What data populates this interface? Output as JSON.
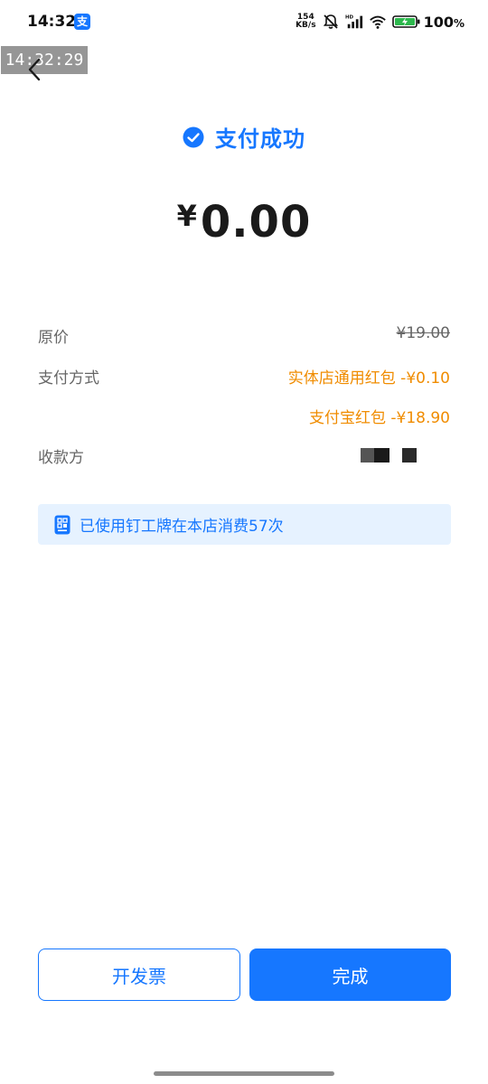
{
  "status_bar": {
    "time": "14:32",
    "app_glyph": "支",
    "net_speed_value": "154",
    "net_speed_unit": "KB/s",
    "hd_label": "HD",
    "battery_percent": "100",
    "battery_unit": "%"
  },
  "overlay": {
    "timestamp": "14:32:29"
  },
  "result": {
    "title": "支付成功",
    "currency": "¥",
    "amount": "0.00"
  },
  "details": {
    "original_price_label": "原价",
    "original_price_value": "¥19.00",
    "payment_method_label": "支付方式",
    "payment_methods": [
      "实体店通用红包 -¥0.10",
      "支付宝红包 -¥18.90"
    ],
    "payee_label": "收款方"
  },
  "notice": {
    "text": "已使用钉工牌在本店消费57次"
  },
  "buttons": {
    "invoice_label": "开发票",
    "done_label": "完成"
  },
  "colors": {
    "accent": "#1677ff",
    "discount": "#f08c00",
    "notice_bg": "#e6f2ff"
  }
}
